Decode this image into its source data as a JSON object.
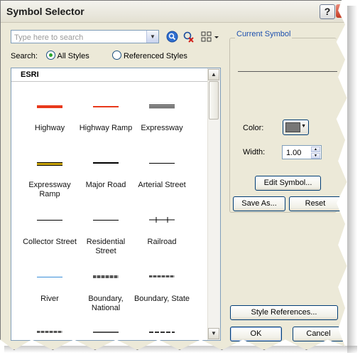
{
  "window": {
    "title": "Symbol Selector",
    "help_label": "?",
    "close_label": "x"
  },
  "search": {
    "placeholder": "Type here to search",
    "value": ""
  },
  "scope": {
    "label": "Search:",
    "options": [
      "All Styles",
      "Referenced Styles"
    ],
    "selected": "All Styles"
  },
  "list": {
    "group": "ESRI",
    "items": [
      {
        "label": "Highway",
        "line_color": "#e8391b"
      },
      {
        "label": "Highway Ramp",
        "line_color": "#e8391b"
      },
      {
        "label": "Expressway",
        "line_color": "#000000"
      },
      {
        "label": "Expressway Ramp",
        "line_color": "#c9a400"
      },
      {
        "label": "Major Road",
        "line_color": "#000000"
      },
      {
        "label": "Arterial Street",
        "line_color": "#000000"
      },
      {
        "label": "Collector Street",
        "line_color": "#000000"
      },
      {
        "label": "Residential Street",
        "line_color": "#000000"
      },
      {
        "label": "Railroad",
        "line_color": "#000000"
      },
      {
        "label": "River",
        "line_color": "#3a8fd8"
      },
      {
        "label": "Boundary, National",
        "line_color": "#444444"
      },
      {
        "label": "Boundary, State",
        "line_color": "#444444"
      }
    ]
  },
  "current_symbol": {
    "title": "Current Symbol",
    "color_label": "Color:",
    "color_value": "#777777",
    "width_label": "Width:",
    "width_value": "1.00",
    "edit_label": "Edit Symbol...",
    "save_as_label": "Save As...",
    "reset_label": "Reset"
  },
  "footer": {
    "style_refs_label": "Style References...",
    "ok_label": "OK",
    "cancel_label": "Cancel"
  }
}
